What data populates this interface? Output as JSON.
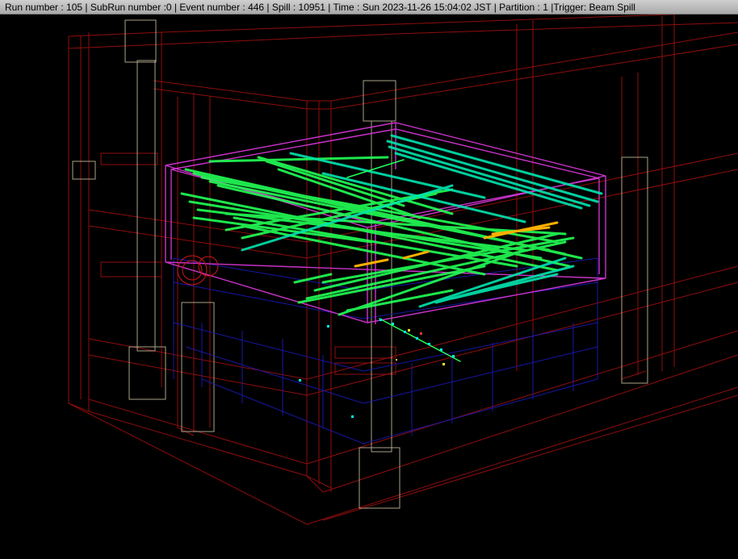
{
  "status": {
    "text": "Run number : 105 | SubRun number :0 | Event number : 446 | Spill : 10951 | Time : Sun 2023-11-26 15:04:02 JST | Partition : 1 |Trigger: Beam Spill"
  },
  "colors": {
    "background": "#000000",
    "support_frame": "#a01010",
    "pillar_frame": "#c8bfa0",
    "inner_detector": "#1a1ab8",
    "detector_box": "#cc33cc",
    "hits_primary": "#22ff55",
    "hits_secondary": "#00e6b0",
    "hits_energetic": "#ffb000",
    "hits_low": "#00ffff"
  },
  "viewer": {
    "name": "3d-event-display"
  }
}
